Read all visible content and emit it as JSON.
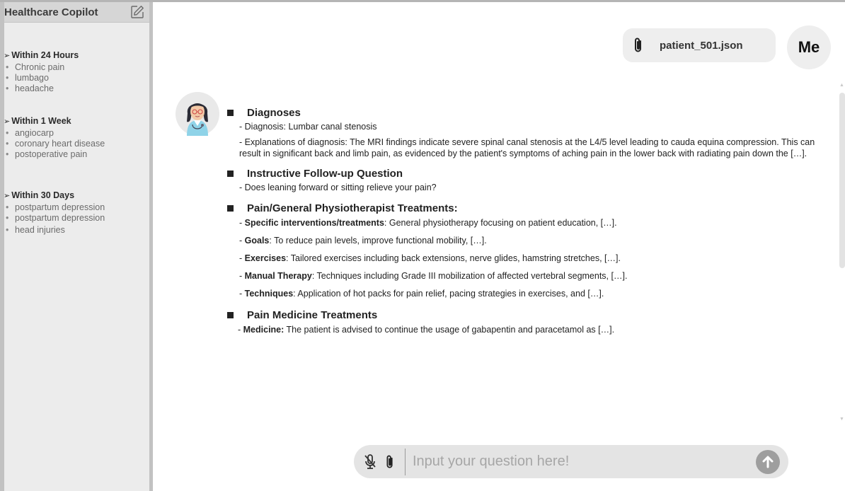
{
  "sidebar": {
    "title": "Healthcare Copilot",
    "new_chat_icon": "edit-square-icon",
    "groups": [
      {
        "title": "Within 24 Hours",
        "items": [
          "Chronic pain",
          "lumbago",
          "headache"
        ]
      },
      {
        "title": "Within 1 Week",
        "items": [
          "angiocarp",
          "coronary heart disease",
          "postoperative pain"
        ]
      },
      {
        "title": "Within 30 Days",
        "items": [
          "postpartum depression",
          "postpartum depression",
          "head injuries"
        ]
      }
    ]
  },
  "user": {
    "avatar_label": "Me",
    "file_name": "patient_501.json",
    "file_icon": "paperclip-icon"
  },
  "response": {
    "sections": [
      {
        "title": "Diagnoses",
        "lines": [
          {
            "text": "- Diagnosis: Lumbar canal stenosis"
          },
          {
            "text": "- Explanations of diagnosis: The MRI findings indicate severe spinal canal stenosis at the L4/5 level leading to cauda equina compression. This can result in significant back and limb pain, as evidenced by the patient's symptoms of aching pain in the lower back with radiating pain down the […]."
          }
        ]
      },
      {
        "title": "Instructive Follow-up Question",
        "lines": [
          {
            "text": "- Does leaning forward or sitting relieve your pain?"
          }
        ]
      },
      {
        "title": "Pain/General Physiotherapist Treatments:",
        "lines": [
          {
            "prefix": "- ",
            "label": "Specific interventions/treatments",
            "text": ": General physiotherapy focusing on patient education, […]."
          },
          {
            "prefix": "- ",
            "label": "Goals",
            "text": ": To reduce pain levels, improve functional mobility, […]."
          },
          {
            "prefix": "- ",
            "label": "Exercises",
            "text": ": Tailored exercises including back extensions, nerve glides, hamstring stretches, […]."
          },
          {
            "prefix": "- ",
            "label": "Manual Therapy",
            "text": ": Techniques including Grade III mobilization of affected vertebral segments, […]."
          },
          {
            "prefix": "- ",
            "label": "Techniques",
            "text": ": Application of hot packs for pain relief, pacing strategies in exercises, and […]."
          }
        ]
      },
      {
        "title": "Pain Medicine Treatments",
        "lines": [
          {
            "prefix": "- ",
            "label": "Medicine:",
            "text": " The patient is advised to continue the usage of gabapentin and paracetamol as […]."
          }
        ]
      }
    ]
  },
  "input": {
    "placeholder": "Input your question here!",
    "mic_icon": "mic-off-icon",
    "attach_icon": "paperclip-icon",
    "send_icon": "arrow-up-icon"
  },
  "colors": {
    "sidebar_bg": "#ececec",
    "sidebar_header_bg": "#d6d6d6",
    "chip_bg": "#eeeeee",
    "input_bg": "#e4e4e4",
    "send_bg": "#9e9e9e"
  }
}
